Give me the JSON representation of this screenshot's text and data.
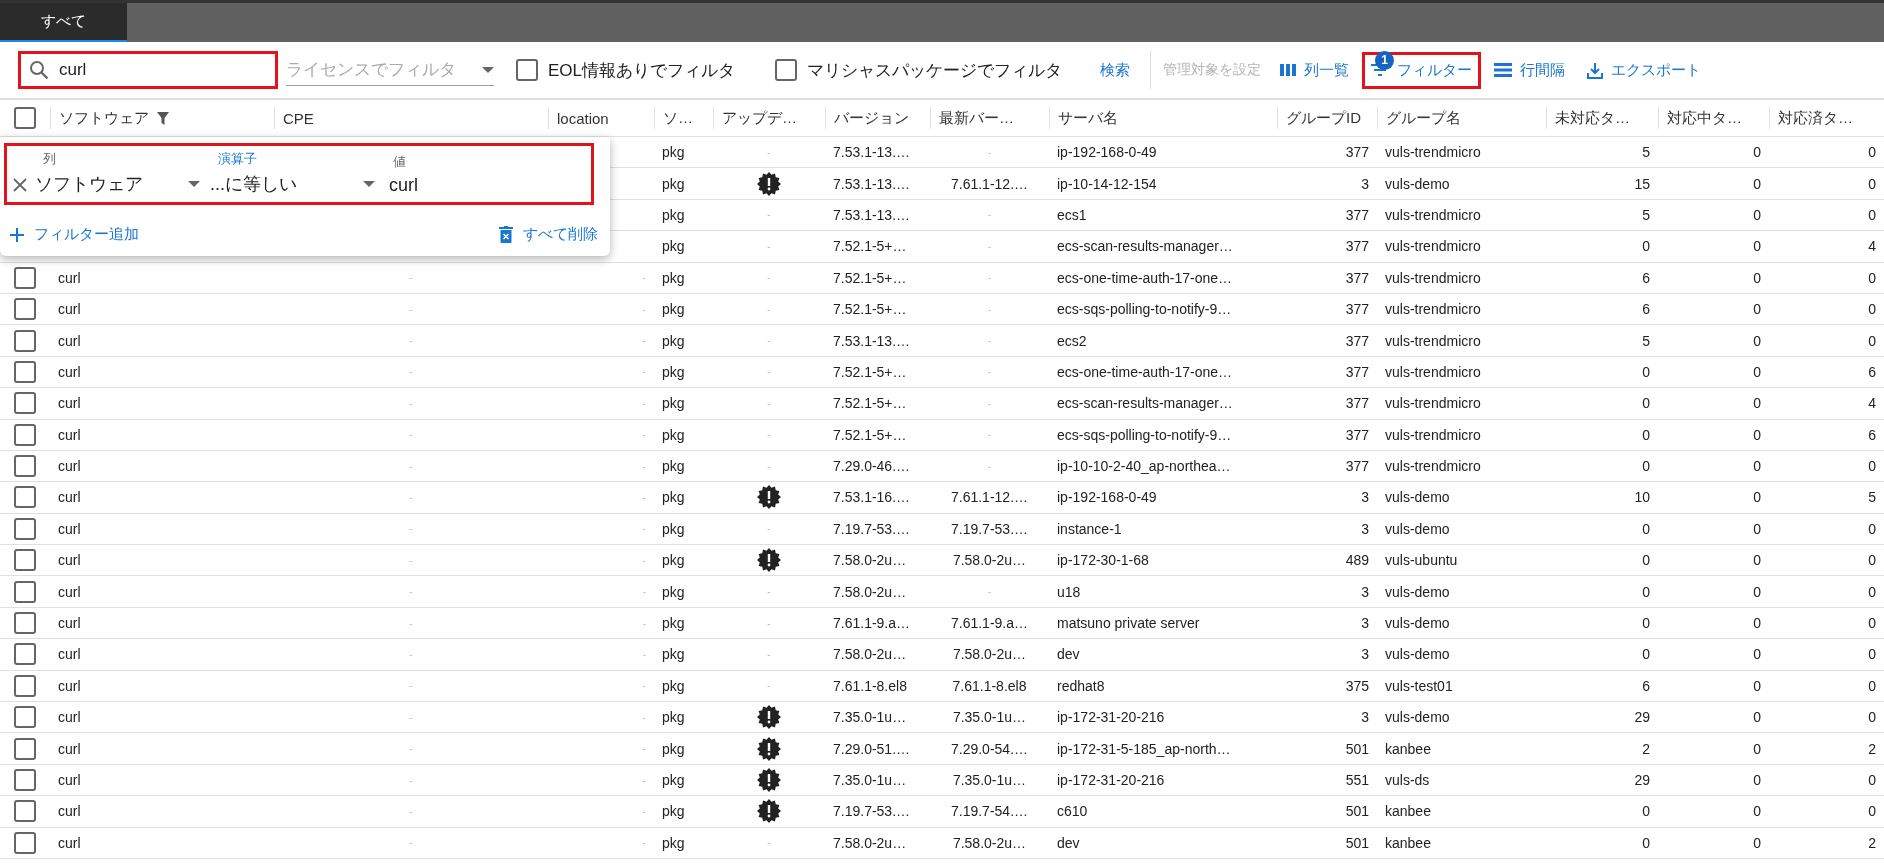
{
  "tabs": [
    {
      "label": "すべて",
      "selected": true
    }
  ],
  "toolbar": {
    "search": {
      "value": "curl",
      "highlighted": true
    },
    "license_filter": {
      "placeholder": "ライセンスでフィルタ"
    },
    "checkboxes": [
      {
        "label": "EOL情報ありでフィルタ",
        "checked": false
      },
      {
        "label": "マリシャスパッケージでフィルタ",
        "checked": false
      }
    ],
    "search_button": "検索",
    "manage_button": {
      "label": "管理対象を設定",
      "disabled": true
    },
    "actions": [
      {
        "kind": "columns",
        "label": "列一覧",
        "highlighted": false
      },
      {
        "kind": "filter",
        "label": "フィルター",
        "badge": "1",
        "highlighted": true
      },
      {
        "kind": "density",
        "label": "行間隔",
        "highlighted": false
      },
      {
        "kind": "export",
        "label": "エクスポート",
        "highlighted": false
      }
    ]
  },
  "filter_panel": {
    "filters": [
      {
        "highlighted": true,
        "fields": [
          {
            "kind": "select",
            "label": "列",
            "value": "ソフトウェア",
            "focused": false
          },
          {
            "kind": "select",
            "label": "演算子",
            "value": "...に等しい",
            "focused": true
          },
          {
            "kind": "input",
            "label": "値",
            "value": "curl",
            "focused": false
          }
        ]
      }
    ],
    "add_button": "フィルター追加",
    "clear_button": "すべて削除"
  },
  "table": {
    "select_all_checked": false,
    "columns": [
      {
        "label": "ソフトウェア",
        "filtered": true
      },
      {
        "label": "CPE",
        "filtered": false
      },
      {
        "label": "location",
        "filtered": false
      },
      {
        "label": "ソ…",
        "filtered": false
      },
      {
        "label": "アップデ…",
        "filtered": false
      },
      {
        "label": "バージョン",
        "filtered": false
      },
      {
        "label": "最新バー…",
        "filtered": false
      },
      {
        "label": "サーバ名",
        "filtered": false
      },
      {
        "label": "グループID",
        "filtered": false
      },
      {
        "label": "グループ名",
        "filtered": false
      },
      {
        "label": "未対応タ…",
        "filtered": false
      },
      {
        "label": "対応中タ…",
        "filtered": false
      },
      {
        "label": "対応済タ…",
        "filtered": false
      }
    ],
    "rows": [
      {
        "column_5": "pkg",
        "update_alert": false,
        "column_6": "-",
        "version": "7.53.1-13.…",
        "column_8": "-",
        "server": "ip-192-168-0-49",
        "group_id": "377",
        "group": "vuls-trendmicro",
        "column_12": "5",
        "column_13": "0",
        "column_14": "0"
      },
      {
        "column_5": "pkg",
        "update_alert": true,
        "version": "7.53.1-13.…",
        "column_8": "7.61.1-12.…",
        "server": "ip-10-14-12-154",
        "group_id": "3",
        "group": "vuls-demo",
        "column_12": "15",
        "column_13": "0",
        "column_14": "0"
      },
      {
        "column_5": "pkg",
        "update_alert": false,
        "column_6": "-",
        "version": "7.53.1-13.…",
        "column_8": "-",
        "server": "ecs1",
        "group_id": "377",
        "group": "vuls-trendmicro",
        "column_12": "5",
        "column_13": "0",
        "column_14": "0"
      },
      {
        "column_5": "pkg",
        "update_alert": false,
        "column_6": "-",
        "version": "7.52.1-5+…",
        "column_8": "-",
        "server": "ecs-scan-results-manager…",
        "group_id": "377",
        "group": "vuls-trendmicro",
        "column_12": "0",
        "column_13": "0",
        "column_14": "4"
      },
      {
        "checked": false,
        "software": "curl",
        "cpe": "-",
        "location": "-",
        "column_5": "pkg",
        "update_alert": false,
        "column_6": "-",
        "version": "7.52.1-5+…",
        "column_8": "-",
        "server": "ecs-one-time-auth-17-one…",
        "group_id": "377",
        "group": "vuls-trendmicro",
        "column_12": "6",
        "column_13": "0",
        "column_14": "0"
      },
      {
        "checked": false,
        "software": "curl",
        "cpe": "-",
        "location": "-",
        "column_5": "pkg",
        "update_alert": false,
        "column_6": "-",
        "version": "7.52.1-5+…",
        "column_8": "-",
        "server": "ecs-sqs-polling-to-notify-9…",
        "group_id": "377",
        "group": "vuls-trendmicro",
        "column_12": "6",
        "column_13": "0",
        "column_14": "0"
      },
      {
        "checked": false,
        "software": "curl",
        "cpe": "-",
        "location": "-",
        "column_5": "pkg",
        "update_alert": false,
        "column_6": "-",
        "version": "7.53.1-13.…",
        "column_8": "-",
        "server": "ecs2",
        "group_id": "377",
        "group": "vuls-trendmicro",
        "column_12": "5",
        "column_13": "0",
        "column_14": "0"
      },
      {
        "checked": false,
        "software": "curl",
        "cpe": "-",
        "location": "-",
        "column_5": "pkg",
        "update_alert": false,
        "column_6": "-",
        "version": "7.52.1-5+…",
        "column_8": "-",
        "server": "ecs-one-time-auth-17-one…",
        "group_id": "377",
        "group": "vuls-trendmicro",
        "column_12": "0",
        "column_13": "0",
        "column_14": "6"
      },
      {
        "checked": false,
        "software": "curl",
        "cpe": "-",
        "location": "-",
        "column_5": "pkg",
        "update_alert": false,
        "column_6": "-",
        "version": "7.52.1-5+…",
        "column_8": "-",
        "server": "ecs-scan-results-manager…",
        "group_id": "377",
        "group": "vuls-trendmicro",
        "column_12": "0",
        "column_13": "0",
        "column_14": "4"
      },
      {
        "checked": false,
        "software": "curl",
        "cpe": "-",
        "location": "-",
        "column_5": "pkg",
        "update_alert": false,
        "column_6": "-",
        "version": "7.52.1-5+…",
        "column_8": "-",
        "server": "ecs-sqs-polling-to-notify-9…",
        "group_id": "377",
        "group": "vuls-trendmicro",
        "column_12": "0",
        "column_13": "0",
        "column_14": "6"
      },
      {
        "checked": false,
        "software": "curl",
        "cpe": "-",
        "location": "-",
        "column_5": "pkg",
        "update_alert": false,
        "column_6": "-",
        "version": "7.29.0-46.…",
        "column_8": "-",
        "server": "ip-10-10-2-40_ap-northea…",
        "group_id": "377",
        "group": "vuls-trendmicro",
        "column_12": "0",
        "column_13": "0",
        "column_14": "0"
      },
      {
        "checked": false,
        "software": "curl",
        "cpe": "-",
        "location": "-",
        "column_5": "pkg",
        "update_alert": true,
        "version": "7.53.1-16.…",
        "column_8": "7.61.1-12.…",
        "server": "ip-192-168-0-49",
        "group_id": "3",
        "group": "vuls-demo",
        "column_12": "10",
        "column_13": "0",
        "column_14": "5"
      },
      {
        "checked": false,
        "software": "curl",
        "cpe": "-",
        "location": "-",
        "column_5": "pkg",
        "update_alert": false,
        "column_6": "-",
        "version": "7.19.7-53.…",
        "column_8": "7.19.7-53.…",
        "server": "instance-1",
        "group_id": "3",
        "group": "vuls-demo",
        "column_12": "0",
        "column_13": "0",
        "column_14": "0"
      },
      {
        "checked": false,
        "software": "curl",
        "cpe": "-",
        "location": "-",
        "column_5": "pkg",
        "update_alert": true,
        "version": "7.58.0-2u…",
        "column_8": "7.58.0-2u…",
        "server": "ip-172-30-1-68",
        "group_id": "489",
        "group": "vuls-ubuntu",
        "column_12": "0",
        "column_13": "0",
        "column_14": "0"
      },
      {
        "checked": false,
        "software": "curl",
        "cpe": "-",
        "location": "-",
        "column_5": "pkg",
        "update_alert": false,
        "column_6": "-",
        "version": "7.58.0-2u…",
        "column_8": "-",
        "server": "u18",
        "group_id": "3",
        "group": "vuls-demo",
        "column_12": "0",
        "column_13": "0",
        "column_14": "0"
      },
      {
        "checked": false,
        "software": "curl",
        "cpe": "-",
        "location": "-",
        "column_5": "pkg",
        "update_alert": false,
        "column_6": "-",
        "version": "7.61.1-9.a…",
        "column_8": "7.61.1-9.a…",
        "server": "matsuno private server",
        "group_id": "3",
        "group": "vuls-demo",
        "column_12": "0",
        "column_13": "0",
        "column_14": "0"
      },
      {
        "checked": false,
        "software": "curl",
        "cpe": "-",
        "location": "-",
        "column_5": "pkg",
        "update_alert": false,
        "column_6": "-",
        "version": "7.58.0-2u…",
        "column_8": "7.58.0-2u…",
        "server": "dev",
        "group_id": "3",
        "group": "vuls-demo",
        "column_12": "0",
        "column_13": "0",
        "column_14": "0"
      },
      {
        "checked": false,
        "software": "curl",
        "cpe": "-",
        "location": "-",
        "column_5": "pkg",
        "update_alert": false,
        "column_6": "-",
        "version": "7.61.1-8.el8",
        "column_8": "7.61.1-8.el8",
        "server": "redhat8",
        "group_id": "375",
        "group": "vuls-test01",
        "column_12": "6",
        "column_13": "0",
        "column_14": "0"
      },
      {
        "checked": false,
        "software": "curl",
        "cpe": "-",
        "location": "-",
        "column_5": "pkg",
        "update_alert": true,
        "version": "7.35.0-1u…",
        "column_8": "7.35.0-1u…",
        "server": "ip-172-31-20-216",
        "group_id": "3",
        "group": "vuls-demo",
        "column_12": "29",
        "column_13": "0",
        "column_14": "0"
      },
      {
        "checked": false,
        "software": "curl",
        "cpe": "-",
        "location": "-",
        "column_5": "pkg",
        "update_alert": true,
        "version": "7.29.0-51.…",
        "column_8": "7.29.0-54.…",
        "server": "ip-172-31-5-185_ap-north…",
        "group_id": "501",
        "group": "kanbee",
        "column_12": "2",
        "column_13": "0",
        "column_14": "2"
      },
      {
        "checked": false,
        "software": "curl",
        "cpe": "-",
        "location": "-",
        "column_5": "pkg",
        "update_alert": true,
        "version": "7.35.0-1u…",
        "column_8": "7.35.0-1u…",
        "server": "ip-172-31-20-216",
        "group_id": "551",
        "group": "vuls-ds",
        "column_12": "29",
        "column_13": "0",
        "column_14": "0"
      },
      {
        "checked": false,
        "software": "curl",
        "cpe": "-",
        "location": "-",
        "column_5": "pkg",
        "update_alert": true,
        "version": "7.19.7-53.…",
        "column_8": "7.19.7-54.…",
        "server": "c610",
        "group_id": "501",
        "group": "kanbee",
        "column_12": "0",
        "column_13": "0",
        "column_14": "0"
      },
      {
        "checked": false,
        "software": "curl",
        "cpe": "-",
        "location": "-",
        "column_5": "pkg",
        "update_alert": false,
        "column_6": "-",
        "version": "7.58.0-2u…",
        "column_8": "7.58.0-2u…",
        "server": "dev",
        "group_id": "501",
        "group": "kanbee",
        "column_12": "0",
        "column_13": "0",
        "column_14": "2"
      }
    ]
  }
}
